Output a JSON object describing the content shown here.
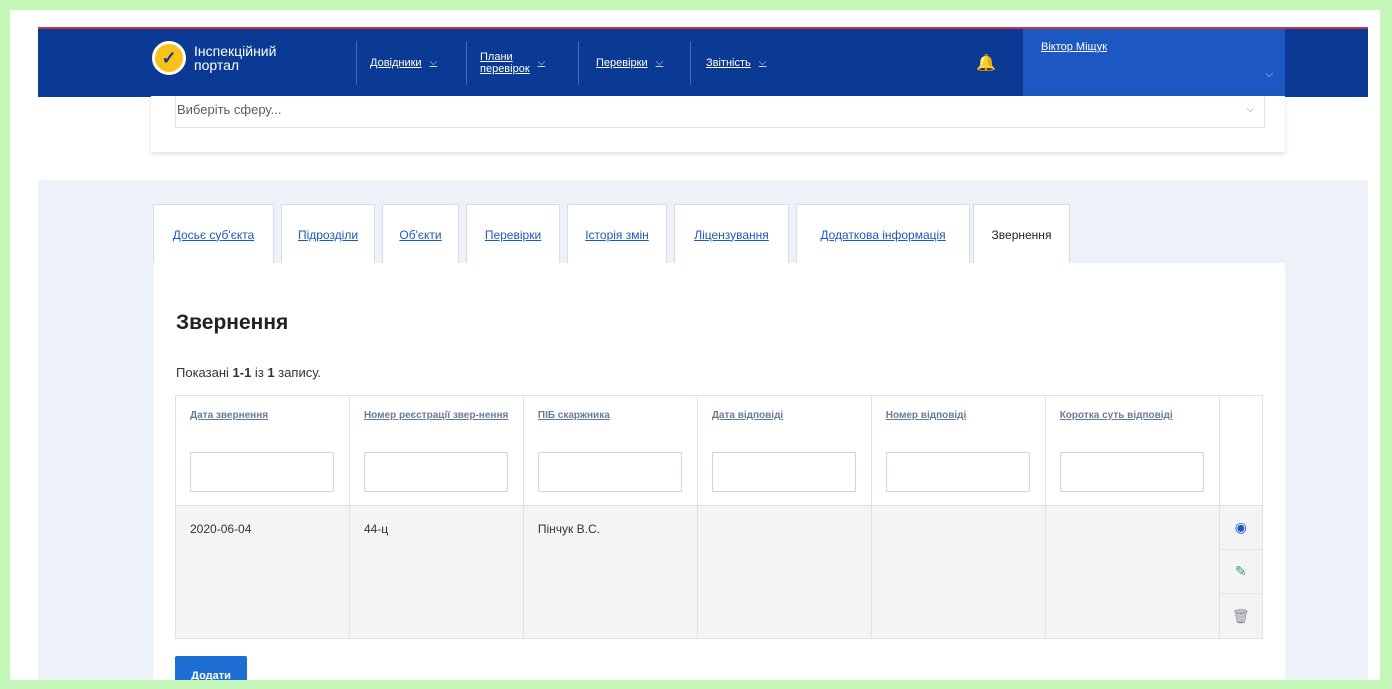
{
  "nav": {
    "logo_line1": "Інспекційний",
    "logo_line2": "портал",
    "items": [
      {
        "label": "Довідники"
      },
      {
        "label1": "Плани",
        "label2": "перевірок"
      },
      {
        "label": "Перевірки"
      },
      {
        "label": "Звітність"
      }
    ],
    "user": "Віктор Міщук"
  },
  "sphere": {
    "placeholder": "Виберіть сферу..."
  },
  "tabs": [
    "Досьє суб'єкта",
    "Підрозділи",
    "Об'єкти",
    "Перевірки",
    "Історія змін",
    "Ліцензування",
    "Додаткова інформація",
    "Звернення"
  ],
  "panel": {
    "title": "Звернення",
    "summary_prefix": "Показані ",
    "summary_range": "1-1",
    "summary_mid": " із ",
    "summary_total": "1",
    "summary_suffix": " запису."
  },
  "table": {
    "columns": [
      "Дата звернення",
      "Номер реєстрації звер-нення",
      "ПІБ скаржника",
      "Дата відповіді",
      "Номер відповіді",
      "Коротка суть відповіді"
    ],
    "rows": [
      [
        "2020-06-04",
        "44-ц",
        "Пінчук В.С.",
        "",
        "",
        ""
      ]
    ]
  },
  "add_button": "Додати",
  "colors": {
    "nav": "#0a3a93",
    "accent": "#1d57c2",
    "edit": "#2fa84f"
  }
}
